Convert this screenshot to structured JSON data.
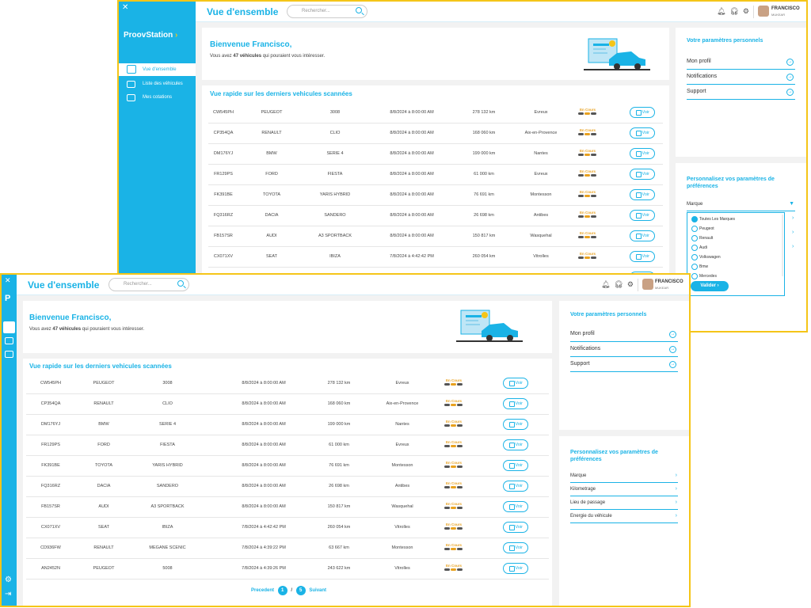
{
  "page_title": "Vue d'ensemble",
  "search_placeholder": "Rechercher...",
  "logo": "ProovStation",
  "user": {
    "name": "FRANCISCO",
    "subtitle": "MUKEAR"
  },
  "welcome": {
    "title": "Bienvenue Francisco,",
    "prefix": "Vous avez ",
    "count": "47 véhicules",
    "suffix": " qui pouraient vous intéresser."
  },
  "nav": [
    "Vue d'ensemble",
    "Liste des véhicules",
    "Mes cotations"
  ],
  "table_title": "Vue rapide sur les derniers vehicules scannées",
  "status_label": "En Cours",
  "voir_label": "Voir",
  "rows": [
    [
      "CW545PH",
      "PEUGEOT",
      "3008",
      "8/8/2024 à 8:00:00 AM",
      "278 132 km",
      "Evreux"
    ],
    [
      "CP354QA",
      "RENAULT",
      "CLIO",
      "8/8/2024 à 8:00:00 AM",
      "168 060 km",
      "Aix-en-Provence"
    ],
    [
      "DM176YJ",
      "BMW",
      "SERIE 4",
      "8/8/2024 à 8:00:00 AM",
      "199 000 km",
      "Nantes"
    ],
    [
      "FR129PS",
      "FORD",
      "FIESTA",
      "8/8/2024 à 8:00:00 AM",
      "61 000 km",
      "Evreux"
    ],
    [
      "FK391BE",
      "TOYOTA",
      "YARIS HYBRID",
      "8/8/2024 à 8:00:00 AM",
      "76 691 km",
      "Montesson"
    ],
    [
      "FQ316RZ",
      "DACIA",
      "SANDERO",
      "8/8/2024 à 8:00:00 AM",
      "26 698 km",
      "Antibes"
    ],
    [
      "FB157SR",
      "AUDI",
      "A3 SPORTBACK",
      "8/8/2024 à 8:00:00 AM",
      "150 817 km",
      "Wasquehal"
    ],
    [
      "CX071XV",
      "SEAT",
      "IBIZA",
      "7/8/2024 à 4:42:42 PM",
      "260 054 km",
      "Vitrolles"
    ],
    [
      "CD936FW",
      "RENAULT",
      "MEGANE SCENIC",
      "7/8/2024 à 4:39:22 PM",
      "63 667 km",
      "Montesson"
    ],
    [
      "AN2452N",
      "PEUGEOT",
      "5008",
      "7/8/2024 à 4:39:26 PM",
      "243 622 km",
      "Vitrolles"
    ]
  ],
  "pagination": {
    "prev": "Precedent",
    "current": "1",
    "sep": "/",
    "total": "5",
    "next": "Suivant"
  },
  "personal": {
    "title": "Votre paramètres personnels",
    "links": [
      "Mon profil",
      "Notifications",
      "Support"
    ]
  },
  "prefs": {
    "title": "Personnalisez vos paramètres de préférences",
    "items": [
      "Marque",
      "Kilometrage",
      "Lieu de passage",
      "Energie du véhicule"
    ]
  },
  "dropdown": {
    "label": "Marque",
    "options": [
      "Toutes Les Marques",
      "Peugeot",
      "Renault",
      "Audi",
      "Volkswagen",
      "Bmw",
      "Mercedes"
    ],
    "button": "Valider"
  },
  "colors": {
    "accent": "#1ab3e6",
    "status": "#e8a11f",
    "border": "#f5c518"
  }
}
